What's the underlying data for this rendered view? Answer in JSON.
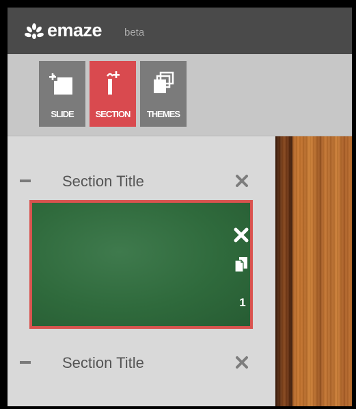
{
  "app": {
    "brand": "emaze",
    "badge": "beta",
    "logo_icon": "emaze-logo-icon"
  },
  "toolbar": {
    "buttons": [
      {
        "label": "SLIDE",
        "icon": "add-slide-icon",
        "active": false
      },
      {
        "label": "SECTION",
        "icon": "add-section-icon",
        "active": true
      },
      {
        "label": "THEMES",
        "icon": "themes-icon",
        "active": false
      }
    ]
  },
  "sidebar": {
    "sections": [
      {
        "title": "Section Title",
        "collapse_icon": "minus-icon",
        "close_icon": "close-icon"
      },
      {
        "title": "Section Title",
        "collapse_icon": "minus-icon",
        "close_icon": "close-icon"
      }
    ],
    "slides": [
      {
        "number": "1",
        "selected": true,
        "delete_icon": "close-icon",
        "duplicate_icon": "duplicate-icon"
      }
    ]
  },
  "colors": {
    "topbar": "#4a4a4a",
    "toolbar": "#c7c7c7",
    "button": "#7b7b7b",
    "accent": "#d94a4f",
    "sidebar": "#d9d9d9",
    "slide_bg": "#2f6a3c",
    "wood": "#c07230"
  }
}
